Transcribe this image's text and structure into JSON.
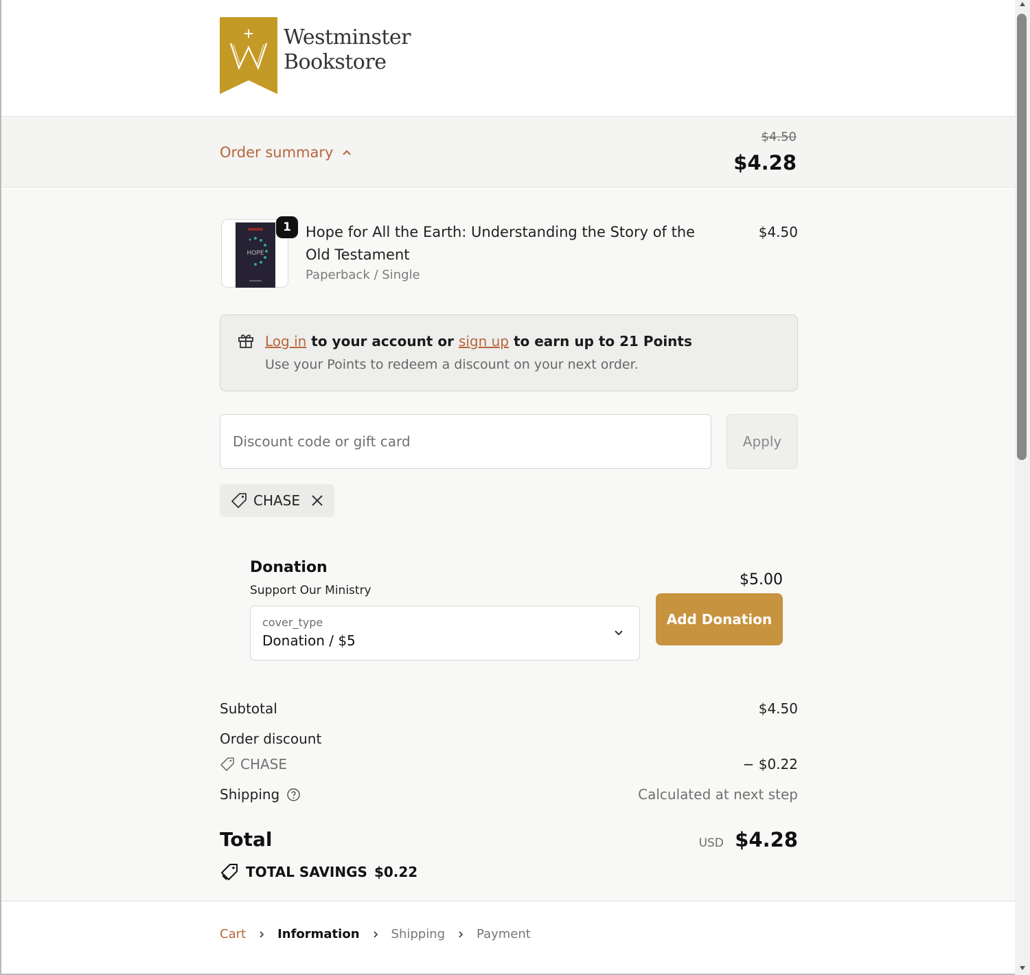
{
  "store": {
    "name_line1": "Westminster",
    "name_line2": "Bookstore",
    "brand_color": "#c49a27",
    "accent_color": "#b8653a"
  },
  "summary": {
    "toggle_label": "Order summary",
    "original_total": "$4.50",
    "total": "$4.28"
  },
  "product": {
    "quantity": "1",
    "title": "Hope for All the Earth: Understanding the Story of the Old Testament",
    "variant": "Paperback / Single",
    "price": "$4.50",
    "cover_text": "HOPE"
  },
  "points": {
    "login_link": "Log in",
    "text_middle": "to your account or",
    "signup_link": "sign up",
    "text_end": "to earn up to 21 Points",
    "subtext": "Use your Points to redeem a discount on your next order."
  },
  "discount": {
    "placeholder": "Discount code or gift card",
    "apply_label": "Apply",
    "applied_code": "CHASE"
  },
  "donation": {
    "title": "Donation",
    "subtitle": "Support Our Ministry",
    "select_label": "cover_type",
    "select_value": "Donation / $5",
    "price": "$5.00",
    "button_label": "Add Donation"
  },
  "totals": {
    "subtotal_label": "Subtotal",
    "subtotal_value": "$4.50",
    "order_discount_label": "Order discount",
    "discount_code": "CHASE",
    "discount_value": "− $0.22",
    "shipping_label": "Shipping",
    "shipping_value": "Calculated at next step",
    "total_label": "Total",
    "currency": "USD",
    "total_value": "$4.28",
    "savings_label": "TOTAL SAVINGS",
    "savings_value": "$0.22"
  },
  "breadcrumb": [
    {
      "label": "Cart",
      "state": "link"
    },
    {
      "label": "Information",
      "state": "current"
    },
    {
      "label": "Shipping",
      "state": "upcoming"
    },
    {
      "label": "Payment",
      "state": "upcoming"
    }
  ]
}
